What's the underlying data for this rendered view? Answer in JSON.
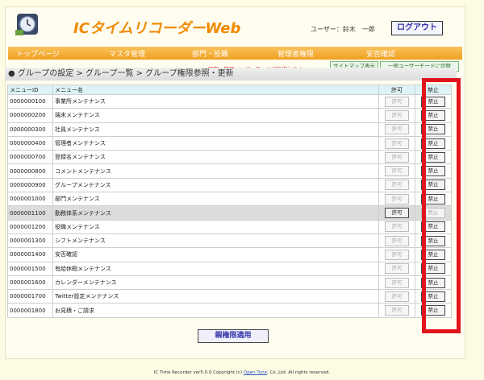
{
  "header": {
    "app_title": "ICタイムリコーダーWeb",
    "user_label": "ユーザー：鈴木　一郎",
    "logout_label": "ログアウト"
  },
  "nav": [
    "トップページ",
    "マスタ管理",
    "部門・役職",
    "管理者権限",
    "安否確認"
  ],
  "subbar": {
    "mode_message": "現在、管理ユーザーモードで操作中です。",
    "sitemap_label": "サイトマップ表示",
    "switch_label": "一般ユーザーモードに切替"
  },
  "breadcrumb": "● グループの設定 > グループ一覧 > グループ権限参照・更新",
  "table": {
    "headers": {
      "id": "メニューID",
      "name": "メニュー名",
      "permit": "許可",
      "deny": "禁止"
    },
    "rows": [
      {
        "id": "0000000100",
        "name": "事業所メンテナンス",
        "permit": "許可",
        "deny": "禁止"
      },
      {
        "id": "0000000200",
        "name": "端末メンテナンス",
        "permit": "許可",
        "deny": "禁止"
      },
      {
        "id": "0000000300",
        "name": "社員メンテナンス",
        "permit": "許可",
        "deny": "禁止"
      },
      {
        "id": "0000000400",
        "name": "管理者メンテナンス",
        "permit": "許可",
        "deny": "禁止"
      },
      {
        "id": "0000000700",
        "name": "登録名メンテナンス",
        "permit": "許可",
        "deny": "禁止"
      },
      {
        "id": "0000000800",
        "name": "コメントメンテナンス",
        "permit": "許可",
        "deny": "禁止"
      },
      {
        "id": "0000000900",
        "name": "グループメンテナンス",
        "permit": "許可",
        "deny": "禁止"
      },
      {
        "id": "0000001000",
        "name": "部門メンテナンス",
        "permit": "許可",
        "deny": "禁止"
      },
      {
        "id": "0000001100",
        "name": "勤務体系メンテナンス",
        "permit": "許可",
        "deny": "禁止"
      },
      {
        "id": "0000001200",
        "name": "役職メンテナンス",
        "permit": "許可",
        "deny": "禁止"
      },
      {
        "id": "0000001300",
        "name": "シフトメンテナンス",
        "permit": "許可",
        "deny": "禁止"
      },
      {
        "id": "0000001400",
        "name": "安否確認",
        "permit": "許可",
        "deny": "禁止"
      },
      {
        "id": "0000001500",
        "name": "有給休暇メンテナンス",
        "permit": "許可",
        "deny": "禁止"
      },
      {
        "id": "0000001600",
        "name": "カレンダーメンテナンス",
        "permit": "許可",
        "deny": "禁止"
      },
      {
        "id": "0000001700",
        "name": "Twitter設定メンテナンス",
        "permit": "許可",
        "deny": "禁止"
      },
      {
        "id": "0000001800",
        "name": "お見積・ご請求",
        "permit": "許可",
        "deny": "禁止"
      }
    ]
  },
  "apply_label": "親権限適用",
  "footer": {
    "before": "IC Time Recorder ver5.0.0 Copyright (c) ",
    "link": "Open Tone",
    "after": ", Co.,Ltd. All rights reserved."
  }
}
